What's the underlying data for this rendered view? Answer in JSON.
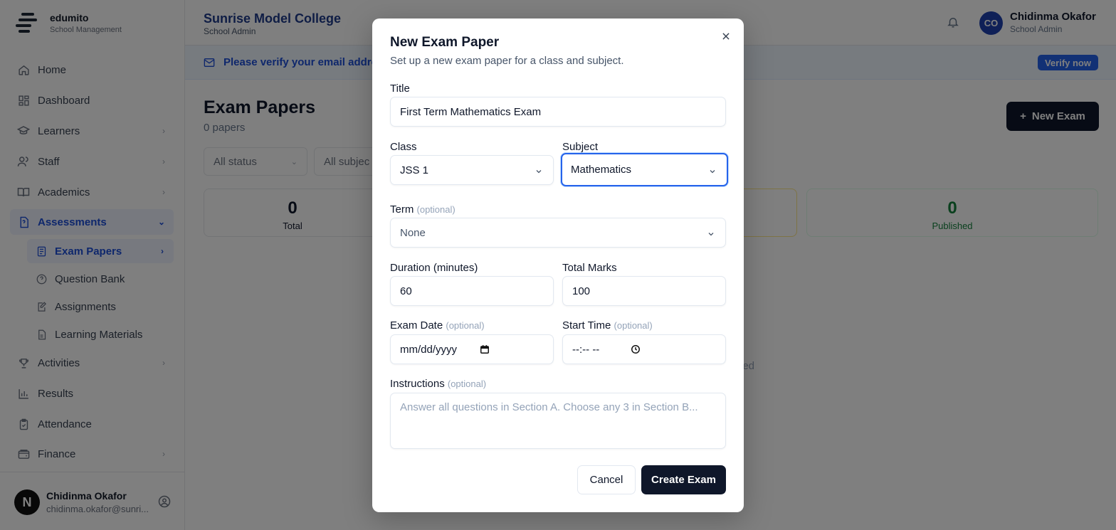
{
  "brand": {
    "name": "edumito",
    "subtitle": "School Management"
  },
  "topbar": {
    "school_name": "Sunrise Model College",
    "school_role": "School Admin",
    "user_initials": "CO",
    "user_name": "Chidinma Okafor",
    "user_role": "School Admin"
  },
  "sidebar": {
    "items": [
      {
        "label": "Home"
      },
      {
        "label": "Dashboard"
      },
      {
        "label": "Learners"
      },
      {
        "label": "Staff"
      },
      {
        "label": "Academics"
      },
      {
        "label": "Assessments"
      },
      {
        "label": "Activities"
      },
      {
        "label": "Results"
      },
      {
        "label": "Attendance"
      },
      {
        "label": "Finance"
      }
    ],
    "sub_items": [
      {
        "label": "Exam Papers"
      },
      {
        "label": "Question Bank"
      },
      {
        "label": "Assignments"
      },
      {
        "label": "Learning Materials"
      }
    ],
    "footer": {
      "avatar_letter": "N",
      "name": "Chidinma Okafor",
      "email": "chidinma.okafor@sunri..."
    }
  },
  "banner": {
    "text": "Please verify your email addre",
    "button": "Verify now"
  },
  "page": {
    "title": "Exam Papers",
    "count": "0 papers",
    "new_button": "New Exam",
    "filters": [
      "All status",
      "All subjec"
    ],
    "stats": [
      {
        "value": "0",
        "label": "Total"
      },
      {
        "value": "0",
        "label": "Published"
      }
    ],
    "empty_fragment": "ed"
  },
  "modal": {
    "title": "New Exam Paper",
    "description": "Set up a new exam paper for a class and subject.",
    "title_label": "Title",
    "title_value": "First Term Mathematics Exam",
    "class_label": "Class",
    "class_value": "JSS 1",
    "subject_label": "Subject",
    "subject_value": "Mathematics",
    "term_label": "Term",
    "optional": "(optional)",
    "term_value": "None",
    "duration_label": "Duration (minutes)",
    "duration_value": "60",
    "marks_label": "Total Marks",
    "marks_value": "100",
    "date_label": "Exam Date",
    "date_placeholder": "mm/dd/yyyy",
    "time_label": "Start Time",
    "time_placeholder": "--:-- --",
    "instructions_label": "Instructions",
    "instructions_placeholder": "Answer all questions in Section A. Choose any 3 in Section B...",
    "cancel": "Cancel",
    "create": "Create Exam"
  },
  "colors": {
    "primary": "#0f172a",
    "accent": "#2563eb",
    "published": "#15803d"
  }
}
